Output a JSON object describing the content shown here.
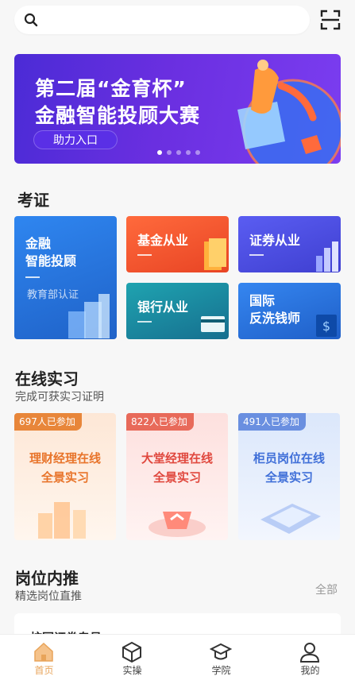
{
  "search": {
    "placeholder": "",
    "icon": "search-icon",
    "scan_icon": "scan-icon"
  },
  "banner": {
    "title_line1": "第二届“金育杯”",
    "title_line2": "金融智能投顾大赛",
    "button": "助力入口",
    "slide_count": 5,
    "active_slide": 1
  },
  "certificate": {
    "title": "考证",
    "cards": [
      {
        "label_line1": "金融",
        "label_line2": "智能投顾",
        "sub": "教育部认证",
        "color": "#2e7ee0"
      },
      {
        "label": "基金从业",
        "color": "#f0552e"
      },
      {
        "label": "证券从业",
        "color": "#4b4fe0"
      },
      {
        "label": "银行从业",
        "color": "#1f8a9c"
      },
      {
        "label_line1": "国际",
        "label_line2": "反洗钱师",
        "color": "#2b6fd6"
      }
    ]
  },
  "internship": {
    "title": "在线实习",
    "subtitle": "完成可获实习证明",
    "cards": [
      {
        "badge": "697人已参加",
        "line1": "理财经理在线",
        "line2": "全景实习",
        "accent": "#e8742a"
      },
      {
        "badge": "822人已参加",
        "line1": "大堂经理在线",
        "line2": "全景实习",
        "accent": "#e0483e"
      },
      {
        "badge": "491人已参加",
        "line1": "柜员岗位在线",
        "line2": "全景实习",
        "accent": "#3f6fd8"
      }
    ]
  },
  "referral": {
    "title": "岗位内推",
    "subtitle": "精选岗位直推",
    "more": "全部",
    "peek_left": "校园证券专员"
  },
  "tabbar": {
    "items": [
      {
        "label": "首页",
        "icon": "home-icon",
        "active": true
      },
      {
        "label": "实操",
        "icon": "cube-icon",
        "active": false
      },
      {
        "label": "学院",
        "icon": "graduation-cap-icon",
        "active": false
      },
      {
        "label": "我的",
        "icon": "user-icon",
        "active": false
      }
    ],
    "active_color": "#e8a45a"
  }
}
